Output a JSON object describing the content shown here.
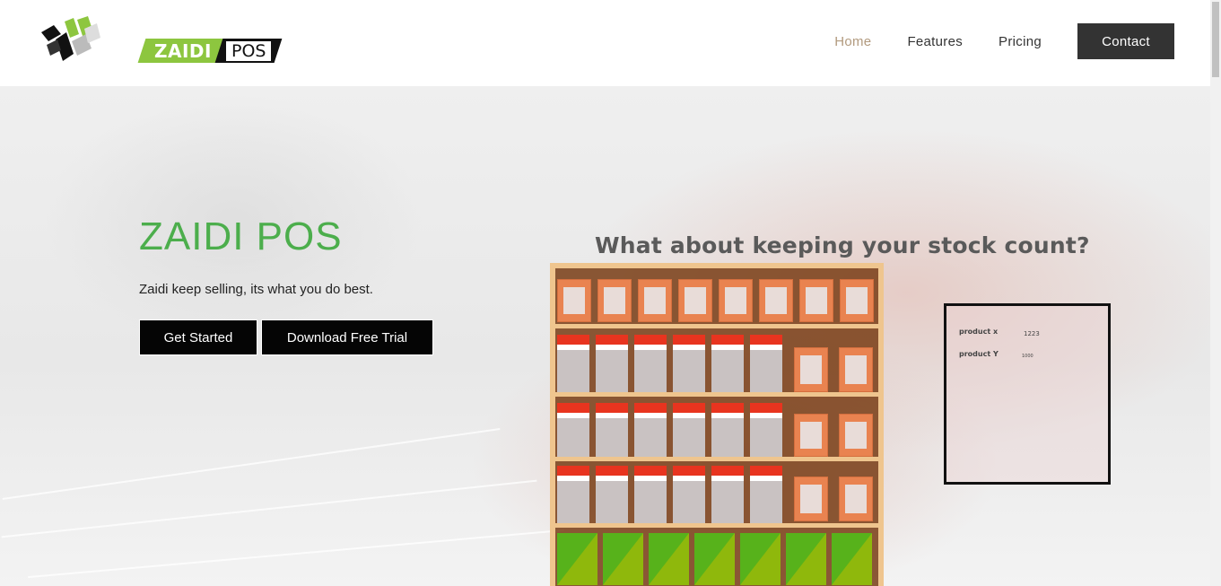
{
  "brand": {
    "logo_part1": "ZAIDI",
    "logo_part2": "POS",
    "accent_green": "#8dc63f",
    "title_green": "#4cae4c"
  },
  "nav": {
    "items": [
      {
        "label": "Home",
        "active": true
      },
      {
        "label": "Features",
        "active": false
      },
      {
        "label": "Pricing",
        "active": false
      }
    ],
    "contact_label": "Contact",
    "active_color": "#b29a7e"
  },
  "hero": {
    "title": "ZAIDI POS",
    "subtitle": "Zaidi keep selling, its what you do best.",
    "buttons": {
      "get_started": "Get Started",
      "download_trial": "Download Free Trial"
    },
    "stock_heading": "What about keeping your stock count?",
    "stock_card": {
      "rows": [
        {
          "name": "product x",
          "value": "1223"
        },
        {
          "name": "product Y",
          "value": "1000"
        }
      ]
    }
  }
}
